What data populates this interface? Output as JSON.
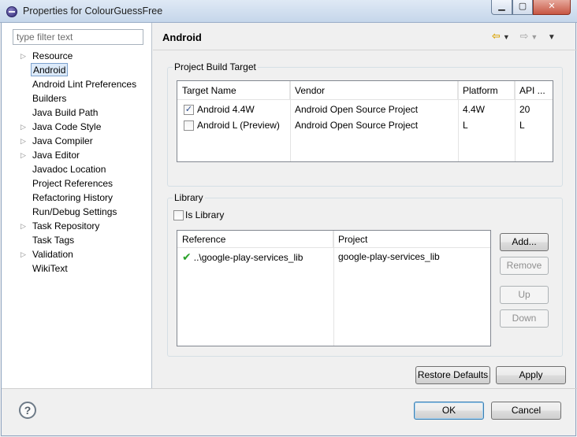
{
  "window": {
    "title": "Properties for ColourGuessFree",
    "controls": {
      "minimize": "▁",
      "maximize": "▢",
      "close": "✕"
    }
  },
  "filter": {
    "placeholder": "type filter text",
    "value": ""
  },
  "tree": {
    "items": [
      {
        "label": "Resource",
        "expandable": true
      },
      {
        "label": "Android",
        "expandable": false,
        "selected": true
      },
      {
        "label": "Android Lint Preferences",
        "expandable": false
      },
      {
        "label": "Builders",
        "expandable": false
      },
      {
        "label": "Java Build Path",
        "expandable": false
      },
      {
        "label": "Java Code Style",
        "expandable": true
      },
      {
        "label": "Java Compiler",
        "expandable": true
      },
      {
        "label": "Java Editor",
        "expandable": true
      },
      {
        "label": "Javadoc Location",
        "expandable": false
      },
      {
        "label": "Project References",
        "expandable": false
      },
      {
        "label": "Refactoring History",
        "expandable": false
      },
      {
        "label": "Run/Debug Settings",
        "expandable": false
      },
      {
        "label": "Task Repository",
        "expandable": true
      },
      {
        "label": "Task Tags",
        "expandable": false
      },
      {
        "label": "Validation",
        "expandable": true
      },
      {
        "label": "WikiText",
        "expandable": false
      }
    ],
    "twisty_glyph": "▷"
  },
  "page": {
    "title": "Android",
    "nav": {
      "back": "⇦",
      "forward": "⇨",
      "dropdown": "▼"
    }
  },
  "build_target": {
    "group_label": "Project Build Target",
    "columns": [
      "Target Name",
      "Vendor",
      "Platform",
      "API ..."
    ],
    "rows": [
      {
        "checked": true,
        "name": "Android 4.4W",
        "vendor": "Android Open Source Project",
        "platform": "4.4W",
        "api": "20"
      },
      {
        "checked": false,
        "name": "Android L (Preview)",
        "vendor": "Android Open Source Project",
        "platform": "L",
        "api": "L"
      }
    ],
    "check_glyph": "✓"
  },
  "library": {
    "group_label": "Library",
    "is_library_label": "Is Library",
    "is_library_checked": false,
    "columns": [
      "Reference",
      "Project"
    ],
    "rows": [
      {
        "status_icon": "✔",
        "reference": "..\\google-play-services_lib",
        "project": "google-play-services_lib"
      }
    ],
    "buttons": {
      "add": "Add...",
      "remove": "Remove",
      "up": "Up",
      "down": "Down"
    }
  },
  "page_buttons": {
    "restore_defaults": "Restore Defaults",
    "apply": "Apply"
  },
  "dialog_buttons": {
    "help": "?",
    "ok": "OK",
    "cancel": "Cancel"
  },
  "colors": {
    "selection_bg": "#dceaf9",
    "selection_border": "#7da2ce",
    "ok_check": "#2aa22a",
    "nav_back": "#d9a100"
  }
}
